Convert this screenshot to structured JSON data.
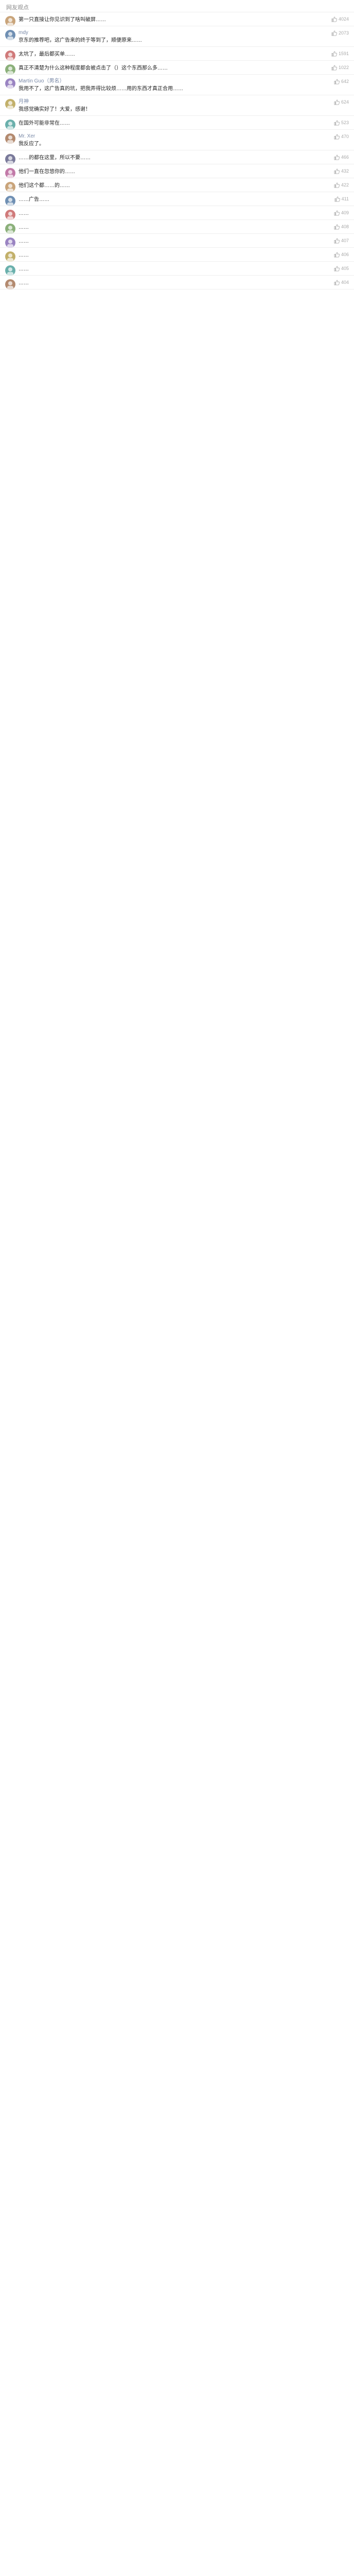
{
  "section_title": "网友观点",
  "comments": [
    {
      "name": "",
      "time": "",
      "likes": "4024",
      "text": "第一只直接让你见识到了啥叫破屏……"
    },
    {
      "name": "mdy",
      "time": "",
      "likes": "2073",
      "text": "京东的推荐吧，这广告来的终于等到了，顺便原来……"
    },
    {
      "name": "",
      "time": "",
      "likes": "1591",
      "text": "太坑了，最后都买单……"
    },
    {
      "name": "",
      "time": "",
      "likes": "1022",
      "text": "真正不清楚为什么这种程度都会被点击了（）这个东西那么多……"
    },
    {
      "name": "Martin Guo（男名）",
      "time": "",
      "likes": "642",
      "text": "我用不了，这广告真的坑，把我弄得比较烦……用的东西才真正合用……"
    },
    {
      "name": "月神",
      "time": "",
      "likes": "624",
      "text": "我感觉确实好了！大爱，感谢！"
    },
    {
      "name": "",
      "time": "",
      "likes": "523",
      "text": "在国外可能非常在……"
    },
    {
      "name": "Mr. Xer",
      "time": "",
      "likes": "470",
      "text": "我反应了。"
    },
    {
      "name": "",
      "time": "",
      "likes": "466",
      "text": "……的都在这里，所以不要……"
    },
    {
      "name": "",
      "time": "",
      "likes": "432",
      "text": "他们一直在忽悠你的……"
    },
    {
      "name": "",
      "time": "",
      "likes": "422",
      "text": "他们这个都……的……"
    },
    {
      "name": "",
      "time": "",
      "likes": "411",
      "text": "……广告……"
    },
    {
      "name": "",
      "time": "",
      "likes": "409",
      "text": "……"
    },
    {
      "name": "",
      "time": "",
      "likes": "408",
      "text": "……"
    },
    {
      "name": "",
      "time": "",
      "likes": "407",
      "text": "……"
    },
    {
      "name": "",
      "time": "",
      "likes": "406",
      "text": "……"
    },
    {
      "name": "",
      "time": "",
      "likes": "405",
      "text": "……"
    },
    {
      "name": "",
      "time": "",
      "likes": "404",
      "text": "……"
    }
  ]
}
